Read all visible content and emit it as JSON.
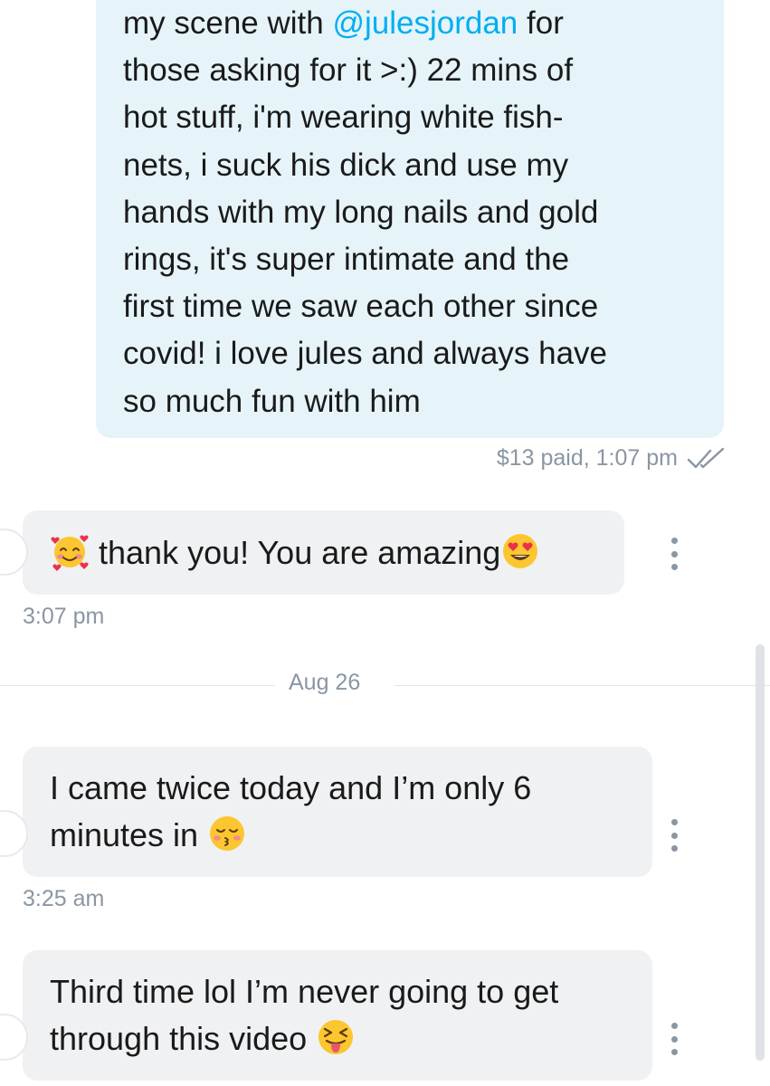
{
  "thread": {
    "sent_message": {
      "lines": [
        [
          "my scene with ",
          "@julesjordan",
          " for"
        ],
        [
          "those asking for it >:) 22 mins of"
        ],
        [
          "hot stuff, i'm wearing white fish-"
        ],
        [
          "nets, i suck his dick and use my"
        ],
        [
          "hands with my long nails and gold"
        ],
        [
          "rings, it's super intimate and the"
        ],
        [
          "first time we saw each other since"
        ],
        [
          "covid! i love jules and always have"
        ],
        [
          "so much fun with him"
        ]
      ],
      "line_1_before": "my scene with ",
      "mention": "@julesjordan",
      "line_1_after": " for",
      "rest": "those asking for it >:) 22 mins of\nhot stuff, i'm wearing white fish-\nnets, i suck his dick and use my\nhands with my long nails and gold\nrings, it's super intimate and the\nfirst time we saw each other since\ncovid! i love jules and always have\nso much fun with him",
      "status": "$13 paid, 1:07 pm",
      "read_icon": "double-check-icon"
    },
    "reply_1": {
      "lead_emoji": "smiling-face-with-hearts",
      "text": " thank you! You are amazing",
      "trail_emoji": "heart-eyes",
      "time": "3:07 pm",
      "menu_icon": "more-vertical-icon"
    },
    "date_divider": "Aug 26",
    "reply_2": {
      "line1": "I came twice today and I’m only 6",
      "line2": "minutes in ",
      "trail_emoji": "kissing-face-closed-eyes",
      "time": "3:25 am",
      "menu_icon": "more-vertical-icon"
    },
    "reply_3": {
      "line1": "Third time lol I’m never going to get",
      "line2": "through this video ",
      "trail_emoji": "squinting-tongue-face",
      "menu_icon": "more-vertical-icon"
    }
  },
  "colors": {
    "accent": "#00aff0",
    "sent_bubble": "#e6f4fa",
    "received_bubble": "#f0f1f3",
    "meta_text": "#8a96a3"
  }
}
